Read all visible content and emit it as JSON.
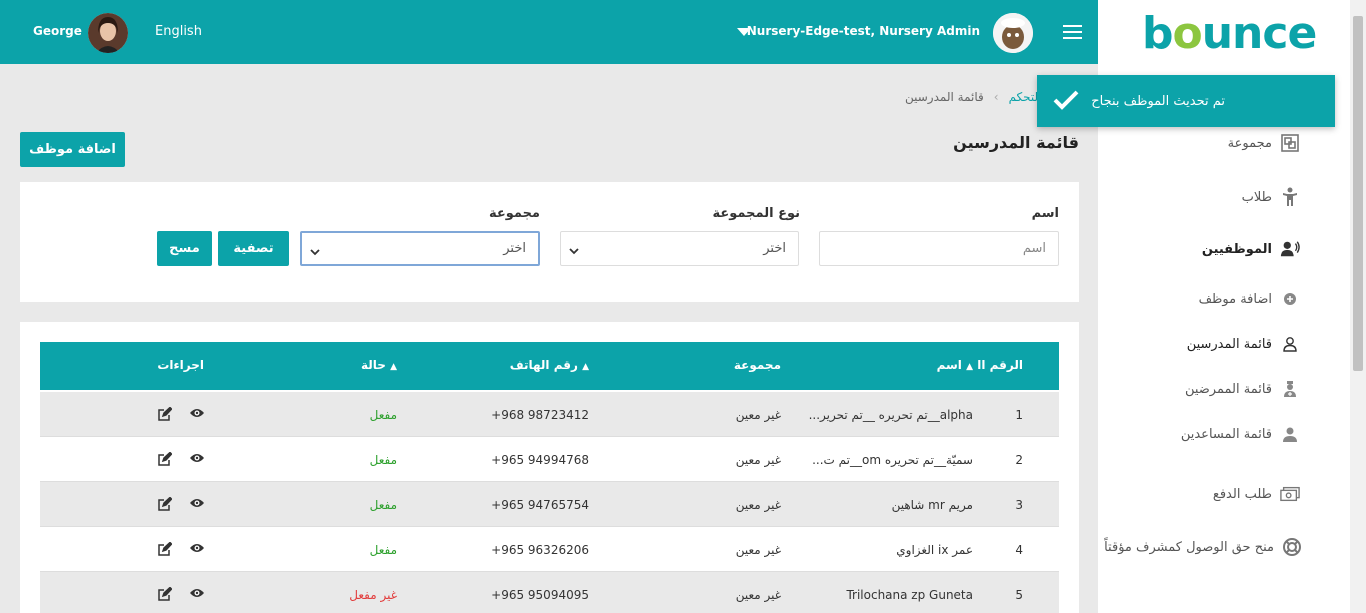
{
  "header": {
    "user_name": "George",
    "language": "English",
    "tenant": "Nursery-Edge-test, Nursery Admin"
  },
  "logo": {
    "text_part1": "b",
    "text_o": "o",
    "text_part2": "unce"
  },
  "toast": {
    "message": "تم تحديث الموظف بنجاح"
  },
  "breadcrumb": {
    "link": "لوحة التحكم",
    "current": "قائمة المدرسين"
  },
  "page_title": "قائمة المدرسين",
  "add_employee_button": "اضافة موظف",
  "sidebar": {
    "items": [
      {
        "label": "مجموعة",
        "icon": "group-icon"
      },
      {
        "label": "طلاب",
        "icon": "student-icon"
      },
      {
        "label": "الموظفيين",
        "icon": "staff-icon"
      },
      {
        "label": "اضافة موظف",
        "icon": "plus-circle-icon"
      },
      {
        "label": "قائمة المدرسين",
        "icon": "teacher-icon"
      },
      {
        "label": "قائمة الممرضين",
        "icon": "nurse-icon"
      },
      {
        "label": "قائمة المساعدين",
        "icon": "assistant-icon"
      },
      {
        "label": "طلب الدفع",
        "icon": "money-icon"
      },
      {
        "label": "منح حق الوصول كمشرف مؤقتاً",
        "icon": "lifebuoy-icon"
      }
    ]
  },
  "filters": {
    "name_label": "اسم",
    "name_placeholder": "اسم",
    "group_type_label": "نوع المجموعة",
    "group_type_value": "اختر",
    "group_label": "مجموعة",
    "group_value": "اختر",
    "filter_button": "تصفية",
    "clear_button": "مسح"
  },
  "table": {
    "columns": {
      "id": "الرقم اا",
      "name": "اسم",
      "group": "مجموعة",
      "phone": "رقم الهاتف",
      "status": "حالة",
      "actions": "اجراءات"
    },
    "rows": [
      {
        "id": "1",
        "name": "alpha__تم تحريره __تم تحرير...",
        "group": "غير معين",
        "phone": "+968 98723412",
        "status": "مفعل",
        "active": true
      },
      {
        "id": "2",
        "name": "سميّة__تم تحريره om__تم ت...",
        "group": "غير معين",
        "phone": "+965 94994768",
        "status": "مفعل",
        "active": true
      },
      {
        "id": "3",
        "name": "مريم mr شاهين",
        "group": "غير معين",
        "phone": "+965 94765754",
        "status": "مفعل",
        "active": true
      },
      {
        "id": "4",
        "name": "عمر ix الغزاوي",
        "group": "غير معين",
        "phone": "+965 96326206",
        "status": "مفعل",
        "active": true
      },
      {
        "id": "5",
        "name": "Trilochana zp Guneta",
        "group": "غير معين",
        "phone": "+965 95094095",
        "status": "غير مفعل",
        "active": false
      }
    ]
  },
  "colors": {
    "accent": "#0ca3a9",
    "active": "#2ca02c",
    "inactive": "#e23b3b"
  }
}
